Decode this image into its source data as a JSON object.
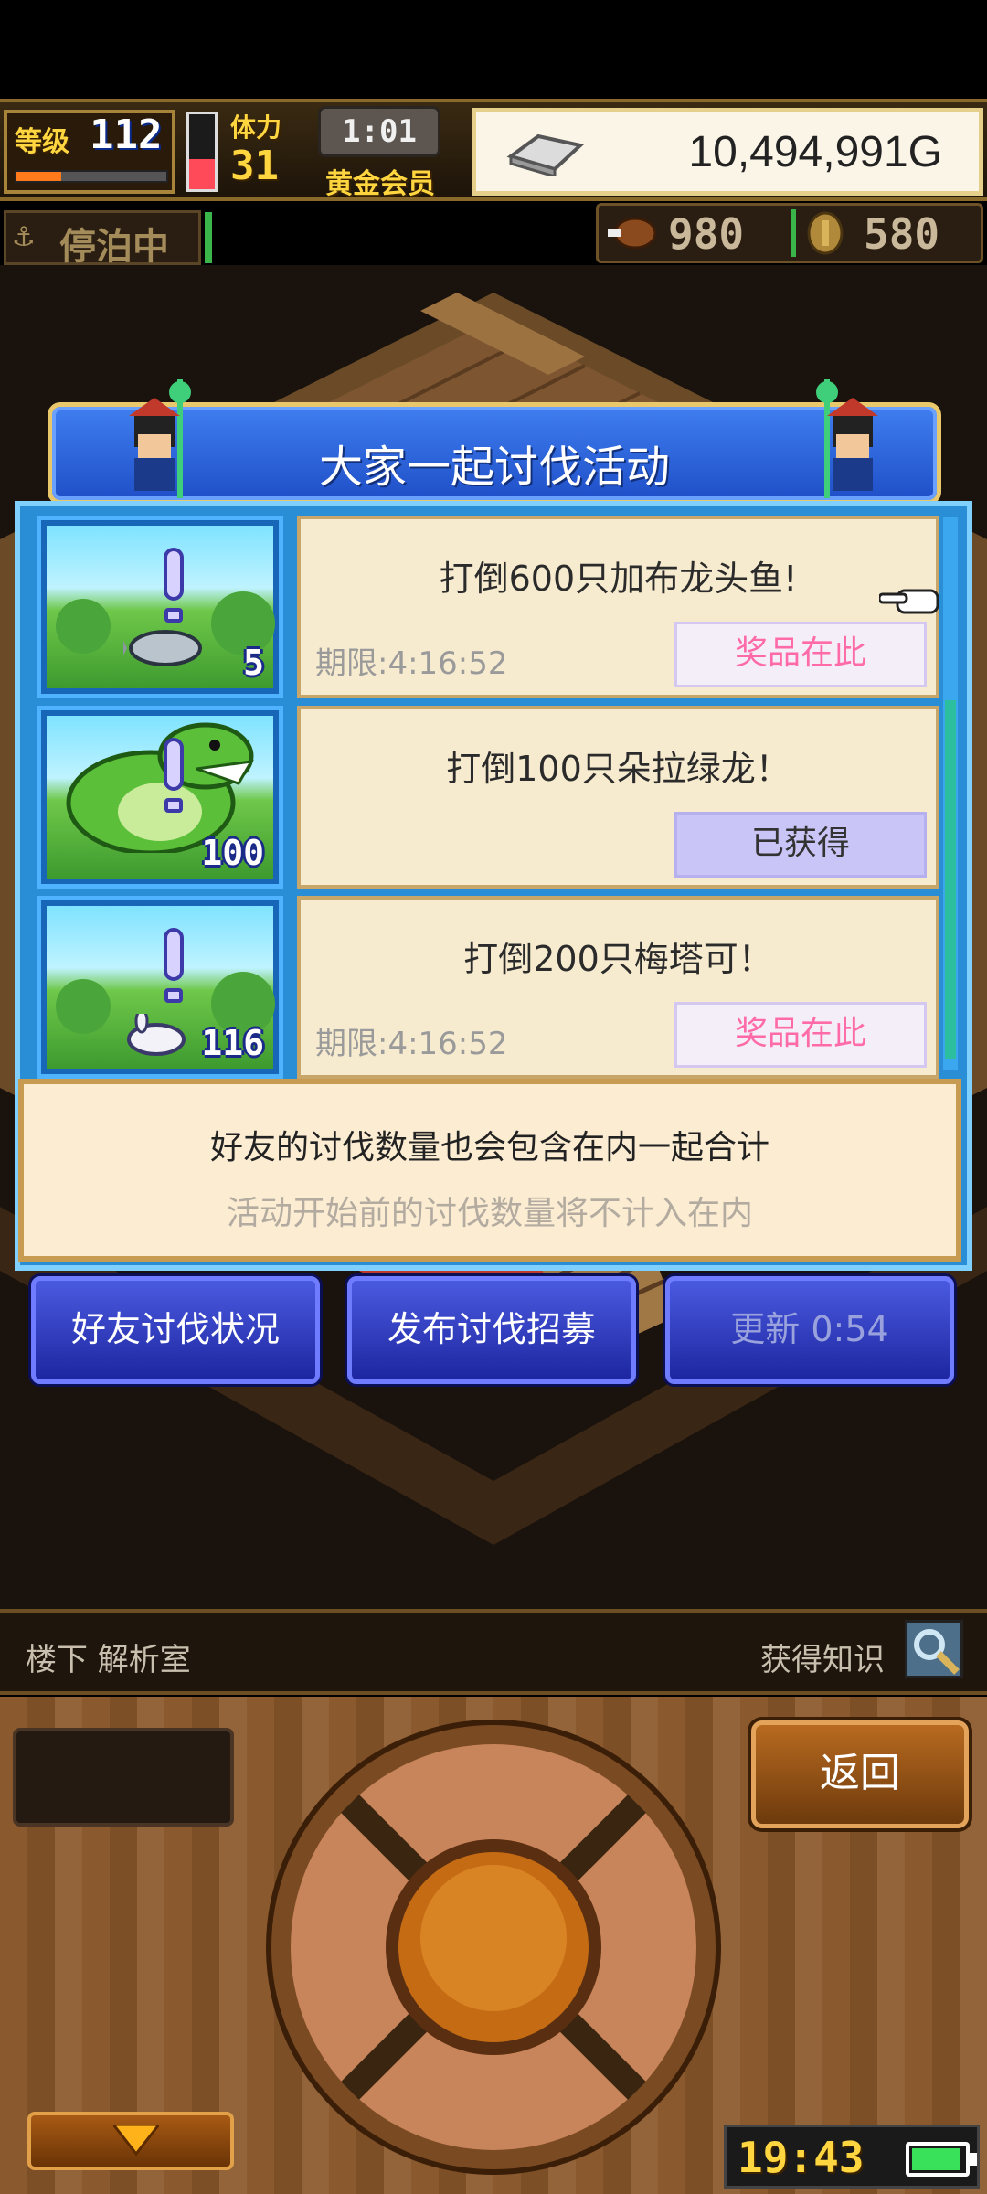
{
  "hud": {
    "level_label": "等级",
    "level_value": "112",
    "stamina_label": "体力",
    "stamina_value": "31",
    "timer": "1:01",
    "membership": "黄金会员",
    "gold": "10,494,991G",
    "status": "停泊中",
    "food": "980",
    "coins": "580"
  },
  "dialog": {
    "title": "大家一起讨伐活动",
    "quests": [
      {
        "title": "打倒600只加布龙头鱼!",
        "deadline": "期限:4:16:52",
        "button": "奖品在此",
        "count": "5",
        "state": "reward"
      },
      {
        "title": "打倒100只朵拉绿龙！",
        "deadline": "",
        "button": "已获得",
        "count": "100",
        "state": "obtained"
      },
      {
        "title": "打倒200只梅塔可！",
        "deadline": "期限:4:16:52",
        "button": "奖品在此",
        "count": "116",
        "state": "reward"
      }
    ],
    "note_line1": "好友的讨伐数量也会包含在内一起合计",
    "note_line2": "活动开始前的讨伐数量将不计入在内",
    "buttons": {
      "friends_status": "好友讨伐状况",
      "publish_recruit": "发布讨伐招募",
      "refresh": "更新 0:54"
    }
  },
  "location": {
    "name": "楼下 解析室",
    "action": "获得知识"
  },
  "controls": {
    "back": "返回",
    "clock": "19:43"
  },
  "colors": {
    "dialog_blue": "#2a8ed6",
    "reward_pink": "#ff6aa8",
    "obtained_purple": "#c9c6f7"
  },
  "icons": [
    "anchor-icon",
    "silver-bar-icon",
    "meat-icon",
    "coin-icon",
    "pointing-hand-icon",
    "magnifier-icon",
    "down-arrow-icon",
    "battery-icon"
  ]
}
